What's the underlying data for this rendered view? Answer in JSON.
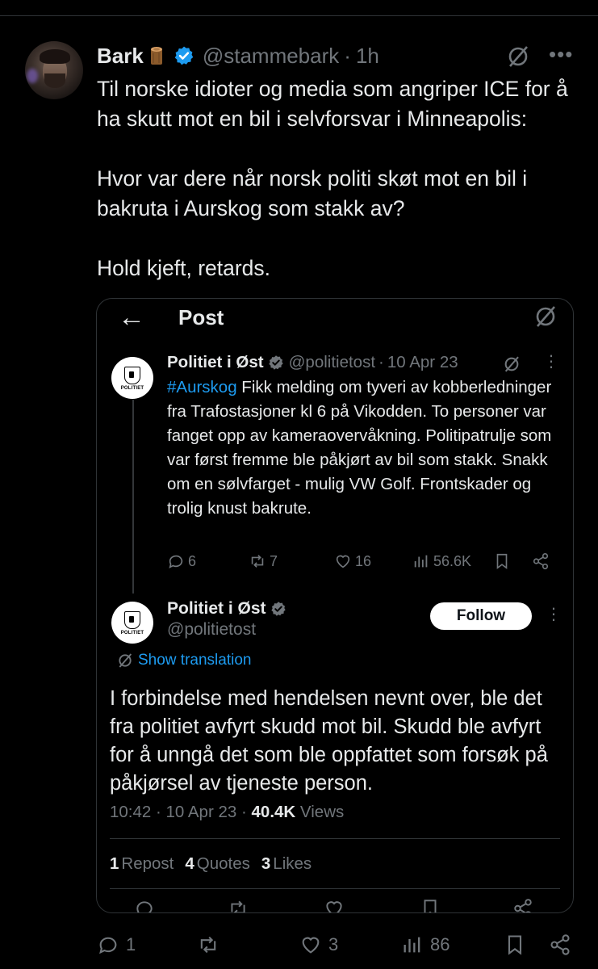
{
  "post": {
    "author_name": "Bark",
    "author_handle": "@stammebark",
    "time": "1h",
    "text": "Til norske idioter og media som angriper ICE for å ha skutt mot en bil i selvforsvar i Minneapolis:\n\nHvor var dere når norsk politi skøt mot en bil i bakruta i Aurskog som stakk av?\n\nHold kjeft, retards.",
    "actions": {
      "replies": "1",
      "reposts": "",
      "likes": "3",
      "views": "86"
    }
  },
  "embed": {
    "title": "Post",
    "quoted": {
      "author_name": "Politiet i Øst",
      "author_handle": "@politietost",
      "date": "10 Apr 23",
      "logo_text": "POLITIET",
      "hashtag": "#Aurskog",
      "text": " Fikk melding om tyveri av kobberledninger fra Trafostasjoner kl 6 på Vikodden. To personer var fanget opp av kameraovervåkning. Politipatrulje som var først fremme ble påkjørt av bil som stakk. Snakk om en sølvfarget - mulig VW Golf. Frontskader og trolig knust bakrute.",
      "actions": {
        "replies": "6",
        "reposts": "7",
        "likes": "16",
        "views": "56.6K"
      }
    },
    "main": {
      "author_name": "Politiet i Øst",
      "author_handle": "@politietost",
      "logo_text": "POLITIET",
      "follow_label": "Follow",
      "show_translation": "Show translation",
      "text": "I forbindelse med hendelsen nevnt over, ble det fra politiet avfyrt skudd mot bil. Skudd ble avfyrt for å unngå det som ble oppfattet som forsøk på påkjørsel av tjeneste person.",
      "time": "10:42 · 10 Apr 23 · ",
      "views_count": "40.4K",
      "views_label": " Views",
      "stats": {
        "reposts_count": "1",
        "reposts_label": "Repost",
        "quotes_count": "4",
        "quotes_label": "Quotes",
        "likes_count": "3",
        "likes_label": "Likes"
      }
    }
  },
  "colors": {
    "background": "#000000",
    "text": "#e7e9ea",
    "muted": "#71767b",
    "accent": "#1d9bf0",
    "border": "#2f3336"
  }
}
